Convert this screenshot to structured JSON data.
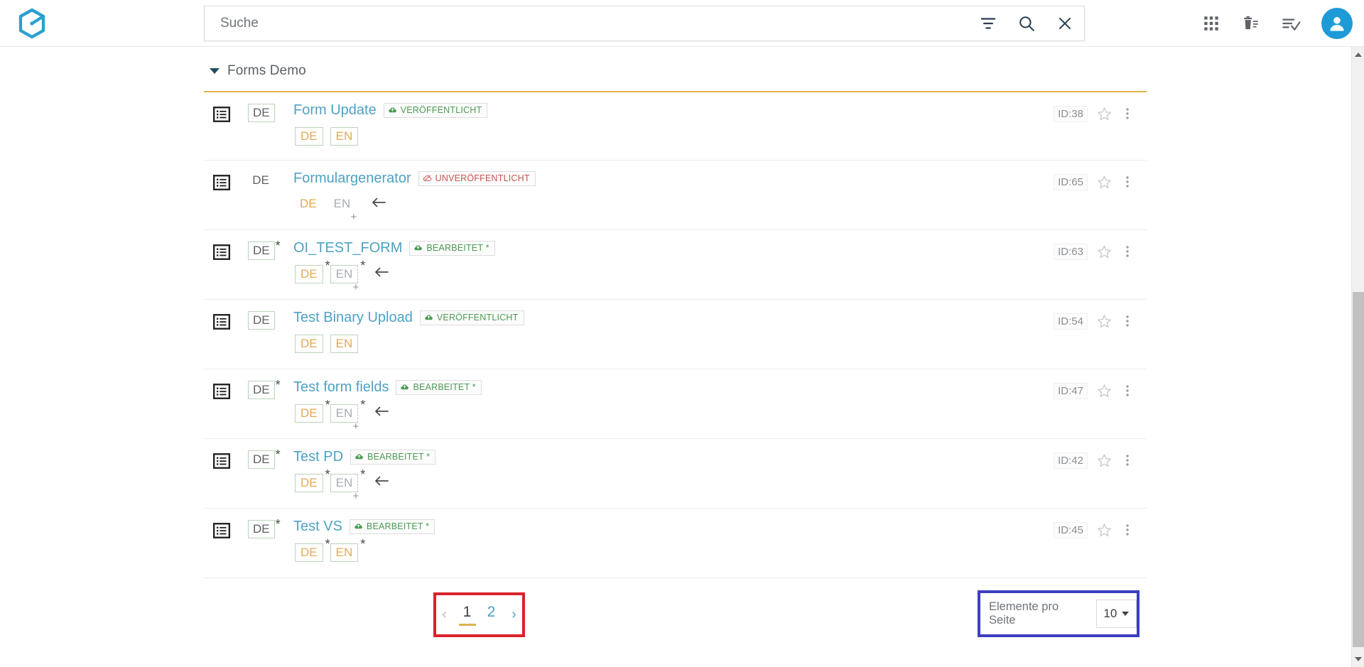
{
  "app": {
    "logo_icon": "hexagon-g-logo",
    "accent_blue": "#4da2c4",
    "accent_gold": "#dfb14e",
    "avatar_color": "#1e9bd7"
  },
  "search": {
    "placeholder": "Suche",
    "value": "",
    "filter_icon": "filter-icon",
    "search_icon": "search-icon",
    "clear_icon": "close-icon"
  },
  "topright": {
    "apps_icon": "apps-grid-icon",
    "trash_icon": "trash-list-icon",
    "tasks_icon": "task-list-check-icon",
    "avatar_icon": "user-avatar-icon"
  },
  "group": {
    "title": "Forms Demo",
    "caret_icon": "chevron-down-icon",
    "expanded": true
  },
  "rows": [
    {
      "doc_icon": "form-list-icon",
      "main_lang": "DE",
      "main_lang_boxed": true,
      "main_lang_star": false,
      "title": "Form Update",
      "status": "VERÖFFENTLICHT",
      "status_type": "published",
      "status_icon": "cloud-up-icon",
      "chips": [
        {
          "label": "DE",
          "style": "boxed-de",
          "star": false,
          "plus": false
        },
        {
          "label": "EN",
          "style": "boxed-en",
          "star": false,
          "plus": false
        }
      ],
      "back_arrow": false,
      "id": "ID:38",
      "star_icon": "star-outline-icon",
      "kebab_icon": "more-vertical-icon"
    },
    {
      "doc_icon": "form-list-icon",
      "main_lang": "DE",
      "main_lang_boxed": false,
      "main_lang_star": false,
      "title": "Formulargenerator",
      "status": "UNVERÖFFENTLICHT",
      "status_type": "unpublished",
      "status_icon": "cloud-off-icon",
      "chips": [
        {
          "label": "DE",
          "style": "plain-de",
          "star": false,
          "plus": false
        },
        {
          "label": "EN",
          "style": "plain-gray",
          "star": false,
          "plus": true
        }
      ],
      "back_arrow": true,
      "id": "ID:65",
      "star_icon": "star-outline-icon",
      "kebab_icon": "more-vertical-icon"
    },
    {
      "doc_icon": "form-list-icon",
      "main_lang": "DE",
      "main_lang_boxed": true,
      "main_lang_star": true,
      "title": "OI_TEST_FORM",
      "status": "BEARBEITET *",
      "status_type": "edited",
      "status_icon": "cloud-up-icon",
      "chips": [
        {
          "label": "DE",
          "style": "boxed-de",
          "star": true,
          "plus": false
        },
        {
          "label": "EN",
          "style": "boxed-gray-dashed",
          "star": true,
          "plus": true
        }
      ],
      "back_arrow": true,
      "id": "ID:63",
      "star_icon": "star-outline-icon",
      "kebab_icon": "more-vertical-icon"
    },
    {
      "doc_icon": "form-list-icon",
      "main_lang": "DE",
      "main_lang_boxed": true,
      "main_lang_star": false,
      "title": "Test Binary Upload",
      "status": "VERÖFFENTLICHT",
      "status_type": "published",
      "status_icon": "cloud-up-icon",
      "chips": [
        {
          "label": "DE",
          "style": "boxed-de",
          "star": false,
          "plus": false
        },
        {
          "label": "EN",
          "style": "boxed-en",
          "star": false,
          "plus": false
        }
      ],
      "back_arrow": false,
      "id": "ID:54",
      "star_icon": "star-outline-icon",
      "kebab_icon": "more-vertical-icon"
    },
    {
      "doc_icon": "form-list-icon",
      "main_lang": "DE",
      "main_lang_boxed": true,
      "main_lang_star": true,
      "title": "Test form fields",
      "status": "BEARBEITET *",
      "status_type": "edited",
      "status_icon": "cloud-up-icon",
      "chips": [
        {
          "label": "DE",
          "style": "boxed-de",
          "star": true,
          "plus": false
        },
        {
          "label": "EN",
          "style": "boxed-gray-dashed",
          "star": true,
          "plus": true
        }
      ],
      "back_arrow": true,
      "id": "ID:47",
      "star_icon": "star-outline-icon",
      "kebab_icon": "more-vertical-icon"
    },
    {
      "doc_icon": "form-list-icon",
      "main_lang": "DE",
      "main_lang_boxed": true,
      "main_lang_star": true,
      "title": "Test PD",
      "status": "BEARBEITET *",
      "status_type": "edited",
      "status_icon": "cloud-up-icon",
      "chips": [
        {
          "label": "DE",
          "style": "boxed-de",
          "star": true,
          "plus": false
        },
        {
          "label": "EN",
          "style": "boxed-gray-dashed",
          "star": true,
          "plus": true
        }
      ],
      "back_arrow": true,
      "id": "ID:42",
      "star_icon": "star-outline-icon",
      "kebab_icon": "more-vertical-icon"
    },
    {
      "doc_icon": "form-list-icon",
      "main_lang": "DE",
      "main_lang_boxed": true,
      "main_lang_star": true,
      "title": "Test VS",
      "status": "BEARBEITET *",
      "status_type": "edited",
      "status_icon": "cloud-up-icon",
      "chips": [
        {
          "label": "DE",
          "style": "boxed-de",
          "star": true,
          "plus": false
        },
        {
          "label": "EN",
          "style": "boxed-en",
          "star": true,
          "plus": false
        }
      ],
      "back_arrow": false,
      "id": "ID:45",
      "star_icon": "star-outline-icon",
      "kebab_icon": "more-vertical-icon"
    }
  ],
  "pagination": {
    "prev_label": "‹",
    "next_label": "›",
    "pages": [
      "1",
      "2"
    ],
    "active_page": "1",
    "annotation_color": "#d9232a"
  },
  "per_page": {
    "label": "Elemente pro Seite",
    "value": "10",
    "caret_icon": "chevron-down-icon",
    "annotation_color": "#3c3fc0"
  },
  "scrollbar": {
    "up_icon": "scroll-up-arrow-icon",
    "down_icon": "scroll-down-arrow-icon",
    "thumb": "scrollbar-thumb"
  }
}
